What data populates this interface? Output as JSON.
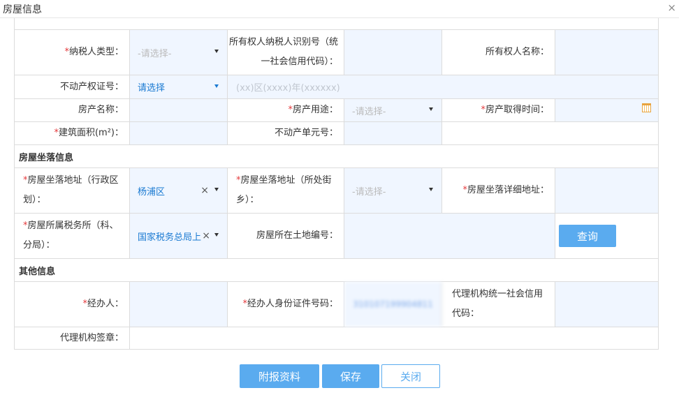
{
  "dialog": {
    "title": "房屋信息",
    "close_glyph": "×"
  },
  "row1": {
    "taxpayer_type_label": "纳税人类型：",
    "taxpayer_type_value": "-请选择-",
    "owner_id_label": "所有权人纳税人识别号（统一社会信用代码）：",
    "owner_name_label": "所有权人名称："
  },
  "row2": {
    "cert_label": "不动产权证号：",
    "cert_value": "请选择",
    "cert_placeholder": "(xx)区(xxxx)年(xxxxxx)"
  },
  "row3": {
    "property_name_label": "房产名称：",
    "usage_label": "房产用途：",
    "usage_value": "-请选择-",
    "acquire_time_label": "房产取得时间："
  },
  "row4": {
    "area_label": "建筑面积(m²)：",
    "unit_no_label": "不动产单元号："
  },
  "location_section": {
    "title": "房屋坐落信息",
    "district_label": "房屋坐落地址（行政区划）：",
    "district_value": "杨浦区",
    "street_label": "房屋坐落地址（所处街乡）：",
    "street_value": "-请选择-",
    "detail_label": "房屋坐落详细地址：",
    "tax_office_label": "房屋所属税务所（科、分局）：",
    "tax_office_value": "国家税务总局上",
    "land_no_label": "房屋所在土地编号：",
    "query_button": "查询"
  },
  "other_section": {
    "title": "其他信息",
    "handler_label": "经办人：",
    "handler_id_label": "经办人身份证件号码：",
    "handler_id_value": "310107199904811",
    "agency_code_label": "代理机构统一社会信用代码：",
    "agency_seal_label": "代理机构签章："
  },
  "buttons": {
    "attach": "附报资料",
    "save": "保存",
    "close": "关闭"
  },
  "colors": {
    "accent": "#5aabef",
    "input_bg": "#f0f6ff",
    "required": "#e4393c",
    "border": "#dcdcdc"
  }
}
